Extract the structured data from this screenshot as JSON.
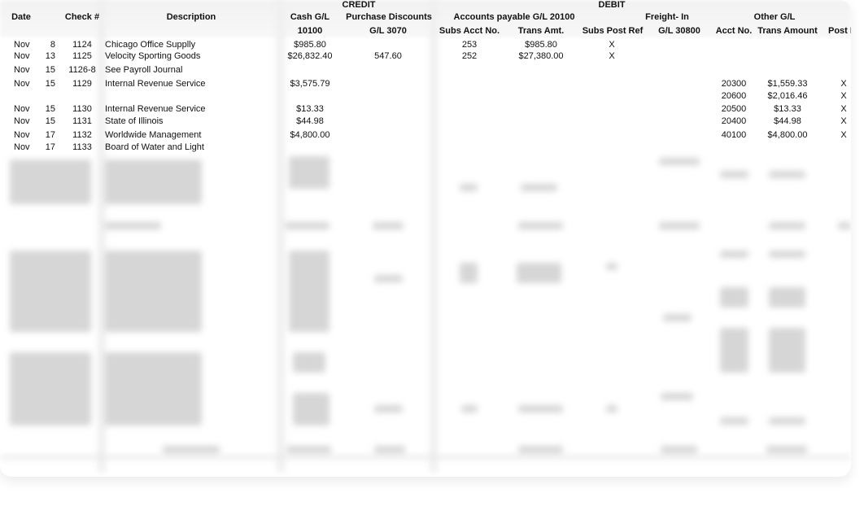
{
  "headers": {
    "credit": "CREDIT",
    "debit": "DEBIT",
    "date": "Date",
    "check": "Check #",
    "description": "Description",
    "cash_gl": "Cash G/L",
    "cash_gl_no": "10100",
    "purchase_discounts": "Purchase Discounts",
    "purchase_discounts_no": "G/L 3070",
    "accounts_payable": "Accounts payable G/L 20100",
    "subs_acct_no": "Subs Acct No.",
    "trans_amt": "Trans Amt.",
    "subs_post_ref": "Subs Post Ref",
    "freight_in": "Freight- In",
    "freight_gl": "G/L 30800",
    "other_gl": "Other G/L",
    "acct_no": "Acct No.",
    "trans_amount": "Trans Amount",
    "post_ref": "Post R"
  },
  "rows": [
    {
      "month": "Nov",
      "day": "8",
      "check": "1124",
      "desc": "Chicago Office Supplly",
      "cash": "$985.80",
      "disc": "",
      "subs": "253",
      "trans": "$985.80",
      "postref": "X",
      "freight": "",
      "acct": "",
      "amount": "",
      "post": ""
    },
    {
      "month": "Nov",
      "day": "13",
      "check": "1125",
      "desc": "Velocity Sporting Goods",
      "cash": "$26,832.40",
      "disc": "547.60",
      "subs": "252",
      "trans": "$27,380.00",
      "postref": "X",
      "freight": "",
      "acct": "",
      "amount": "",
      "post": ""
    },
    {
      "month": "Nov",
      "day": "15",
      "check": "1126-8",
      "desc": "See Payroll Journal",
      "cash": "",
      "disc": "",
      "subs": "",
      "trans": "",
      "postref": "",
      "freight": "",
      "acct": "",
      "amount": "",
      "post": ""
    },
    {
      "month": "Nov",
      "day": "15",
      "check": "1129",
      "desc": "Internal Revenue Service",
      "cash": "$3,575.79",
      "disc": "",
      "subs": "",
      "trans": "",
      "postref": "",
      "freight": "",
      "acct": "20300",
      "amount": "$1,559.33",
      "post": "X"
    },
    {
      "month": "",
      "day": "",
      "check": "",
      "desc": "",
      "cash": "",
      "disc": "",
      "subs": "",
      "trans": "",
      "postref": "",
      "freight": "",
      "acct": "20600",
      "amount": "$2,016.46",
      "post": "X"
    },
    {
      "month": "Nov",
      "day": "15",
      "check": "1130",
      "desc": "Internal Revenue Service",
      "cash": "$13.33",
      "disc": "",
      "subs": "",
      "trans": "",
      "postref": "",
      "freight": "",
      "acct": "20500",
      "amount": "$13.33",
      "post": "X"
    },
    {
      "month": "Nov",
      "day": "15",
      "check": "1131",
      "desc": "State of Illinois",
      "cash": "$44.98",
      "disc": "",
      "subs": "",
      "trans": "",
      "postref": "",
      "freight": "",
      "acct": "20400",
      "amount": "$44.98",
      "post": "X"
    },
    {
      "month": "Nov",
      "day": "17",
      "check": "1132",
      "desc": "Worldwide Management",
      "cash": "$4,800.00",
      "disc": "",
      "subs": "",
      "trans": "",
      "postref": "",
      "freight": "",
      "acct": "40100",
      "amount": "$4,800.00",
      "post": "X"
    },
    {
      "month": "Nov",
      "day": "17",
      "check": "1133",
      "desc": "Board of Water and Light",
      "cash": "",
      "disc": "",
      "subs": "",
      "trans": "",
      "postref": "",
      "freight": "",
      "acct": "",
      "amount": "",
      "post": ""
    }
  ]
}
